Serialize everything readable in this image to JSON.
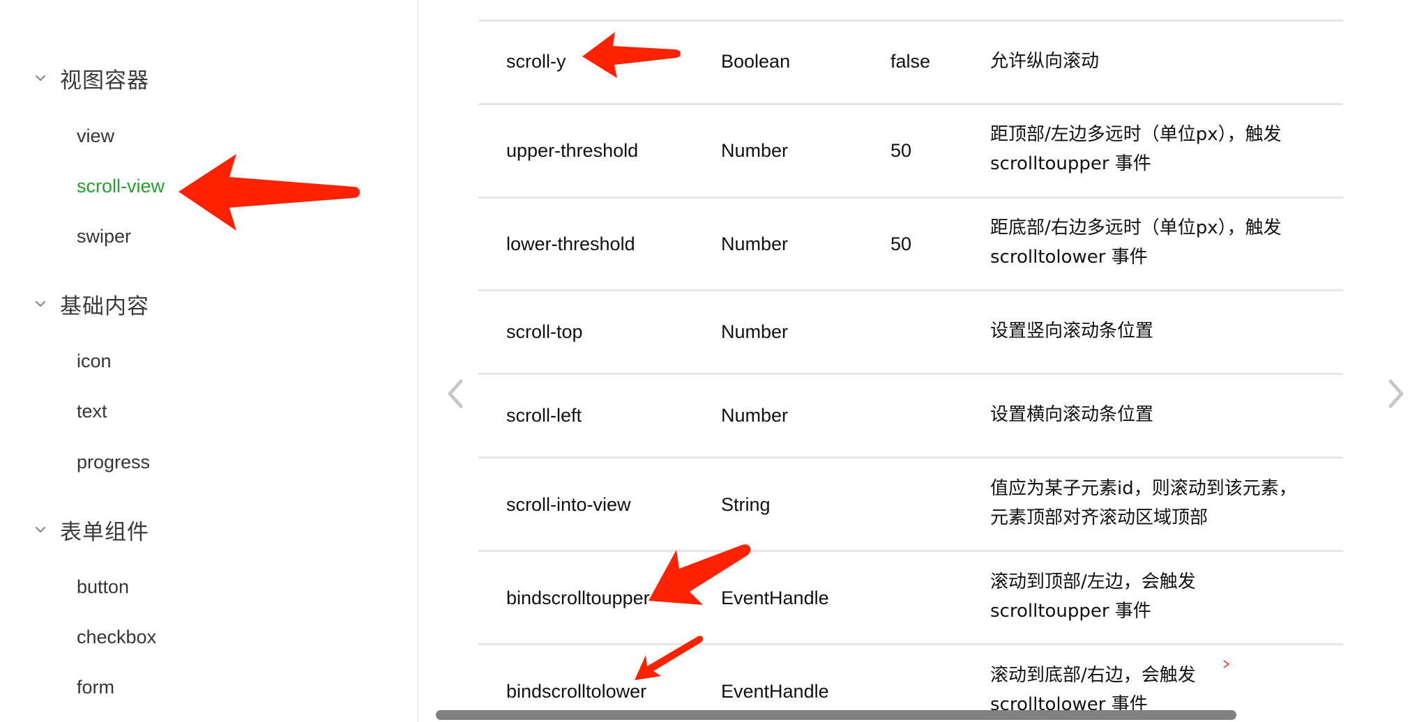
{
  "sidebar": {
    "sections": [
      {
        "title": "视图容器",
        "expanded": true,
        "items": [
          {
            "label": "view",
            "active": false
          },
          {
            "label": "scroll-view",
            "active": true
          },
          {
            "label": "swiper",
            "active": false
          }
        ]
      },
      {
        "title": "基础内容",
        "expanded": true,
        "items": [
          {
            "label": "icon",
            "active": false
          },
          {
            "label": "text",
            "active": false
          },
          {
            "label": "progress",
            "active": false
          }
        ]
      },
      {
        "title": "表单组件",
        "expanded": true,
        "items": [
          {
            "label": "button",
            "active": false
          },
          {
            "label": "checkbox",
            "active": false
          },
          {
            "label": "form",
            "active": false
          }
        ]
      }
    ],
    "active_color": "#22a22a"
  },
  "table": {
    "rows": [
      {
        "attr": "scroll-y",
        "type": "Boolean",
        "default": "false",
        "desc": "允许纵向滚动"
      },
      {
        "attr": "upper-threshold",
        "type": "Number",
        "default": "50",
        "desc": "距顶部/左边多远时（单位px），触发 scrolltoupper 事件"
      },
      {
        "attr": "lower-threshold",
        "type": "Number",
        "default": "50",
        "desc": "距底部/右边多远时（单位px），触发 scrolltolower 事件"
      },
      {
        "attr": "scroll-top",
        "type": "Number",
        "default": "",
        "desc": "设置竖向滚动条位置"
      },
      {
        "attr": "scroll-left",
        "type": "Number",
        "default": "",
        "desc": "设置横向滚动条位置"
      },
      {
        "attr": "scroll-into-view",
        "type": "String",
        "default": "",
        "desc": "值应为某子元素id，则滚动到该元素，元素顶部对齐滚动区域顶部"
      },
      {
        "attr": "bindscrolltoupper",
        "type": "EventHandle",
        "default": "",
        "desc": "滚动到顶部/左边，会触发 scrolltoupper 事件"
      },
      {
        "attr": "bindscrolltolower",
        "type": "EventHandle",
        "default": "",
        "desc": "滚动到底部/右边，会触发 scrolltolower 事件"
      }
    ]
  },
  "pager": {
    "prev_icon": "chevron-left-icon",
    "next_icon": "chevron-right-icon"
  },
  "annotations": {
    "arrow_color": "#ff2200",
    "arrows": [
      "scroll-view",
      "scroll-y",
      "bindscrolltoupper",
      "bindscrolltolower"
    ]
  }
}
